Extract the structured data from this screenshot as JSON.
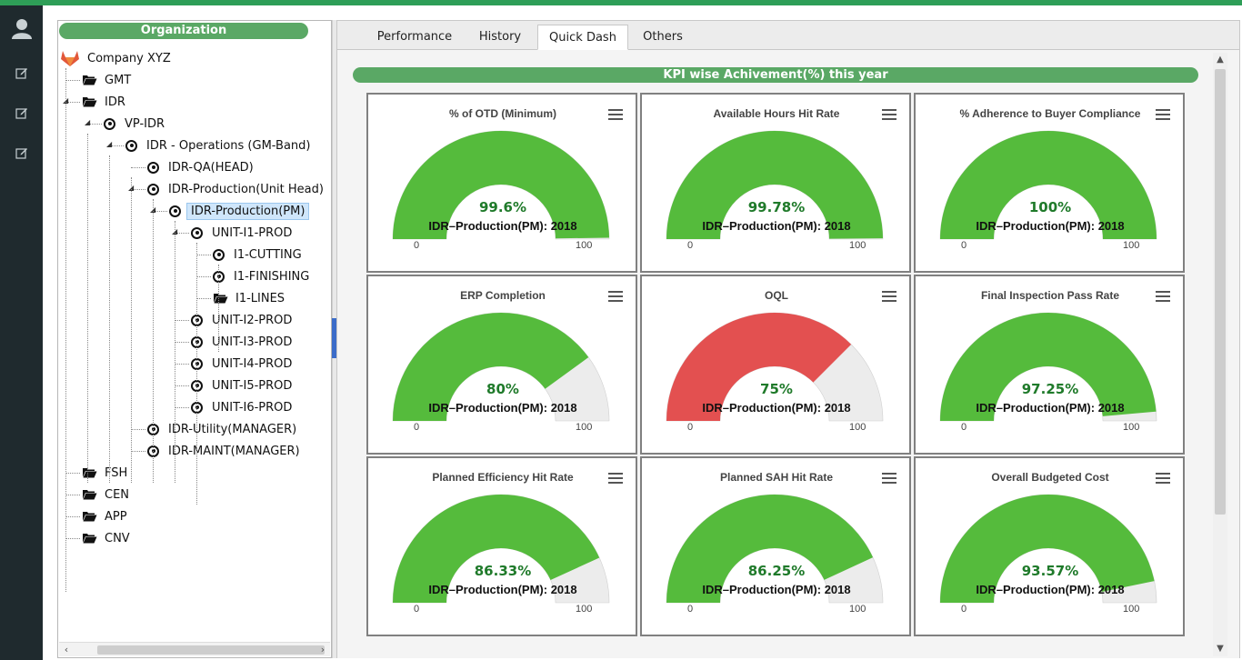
{
  "colors": {
    "brand_green": "#5aa865",
    "gauge_green": "#55bb3c",
    "gauge_red": "#e35050",
    "gauge_track": "#ececec",
    "rail_bg": "#1f2a2e",
    "value_text": "#1f7a2a"
  },
  "rail": {
    "icons": [
      "user-icon",
      "edit-icon",
      "edit-icon",
      "edit-icon"
    ]
  },
  "tree": {
    "header": "Organization",
    "root": "Company XYZ",
    "nodes": [
      {
        "label": "GMT",
        "type": "folder"
      },
      {
        "label": "IDR",
        "type": "folder"
      },
      {
        "label": "VP-IDR",
        "type": "unit"
      },
      {
        "label": "IDR - Operations (GM-Band)",
        "type": "unit"
      },
      {
        "label": "IDR-QA(HEAD)",
        "type": "unit"
      },
      {
        "label": "IDR-Production(Unit Head)",
        "type": "unit"
      },
      {
        "label": "IDR-Production(PM)",
        "type": "unit",
        "selected": true
      },
      {
        "label": "UNIT-I1-PROD",
        "type": "unit"
      },
      {
        "label": "I1-CUTTING",
        "type": "unit"
      },
      {
        "label": "I1-FINISHING",
        "type": "unit"
      },
      {
        "label": "I1-LINES",
        "type": "folder"
      },
      {
        "label": "UNIT-I2-PROD",
        "type": "unit"
      },
      {
        "label": "UNIT-I3-PROD",
        "type": "unit"
      },
      {
        "label": "UNIT-I4-PROD",
        "type": "unit"
      },
      {
        "label": "UNIT-I5-PROD",
        "type": "unit"
      },
      {
        "label": "UNIT-I6-PROD",
        "type": "unit"
      },
      {
        "label": "IDR-Utility(MANAGER)",
        "type": "unit"
      },
      {
        "label": "IDR-MAINT(MANAGER)",
        "type": "unit"
      },
      {
        "label": "FSH",
        "type": "folder"
      },
      {
        "label": "CEN",
        "type": "folder"
      },
      {
        "label": "APP",
        "type": "folder"
      },
      {
        "label": "CNV",
        "type": "folder"
      }
    ]
  },
  "tabs": [
    {
      "label": "Performance",
      "active": false
    },
    {
      "label": "History",
      "active": false
    },
    {
      "label": "Quick Dash",
      "active": true
    },
    {
      "label": "Others",
      "active": false
    }
  ],
  "dashboard": {
    "header": "KPI wise Achivement(%) this year",
    "min_label": "0",
    "max_label": "100",
    "subtitle": "IDR–Production(PM): 2018",
    "cards": [
      {
        "title": "% of OTD (Minimum)",
        "value": 99.6,
        "value_text": "99.6%",
        "color": "green"
      },
      {
        "title": "Available Hours Hit Rate",
        "value": 99.78,
        "value_text": "99.78%",
        "color": "green"
      },
      {
        "title": "% Adherence to Buyer Compliance",
        "value": 100,
        "value_text": "100%",
        "color": "green"
      },
      {
        "title": "ERP Completion",
        "value": 80,
        "value_text": "80%",
        "color": "green"
      },
      {
        "title": "OQL",
        "value": 75,
        "value_text": "75%",
        "color": "red"
      },
      {
        "title": "Final Inspection Pass Rate",
        "value": 97.25,
        "value_text": "97.25%",
        "color": "green"
      },
      {
        "title": "Planned Efficiency Hit Rate",
        "value": 86.33,
        "value_text": "86.33%",
        "color": "green"
      },
      {
        "title": "Planned SAH Hit Rate",
        "value": 86.25,
        "value_text": "86.25%",
        "color": "green"
      },
      {
        "title": "Overall Budgeted Cost",
        "value": 93.57,
        "value_text": "93.57%",
        "color": "green"
      }
    ]
  }
}
